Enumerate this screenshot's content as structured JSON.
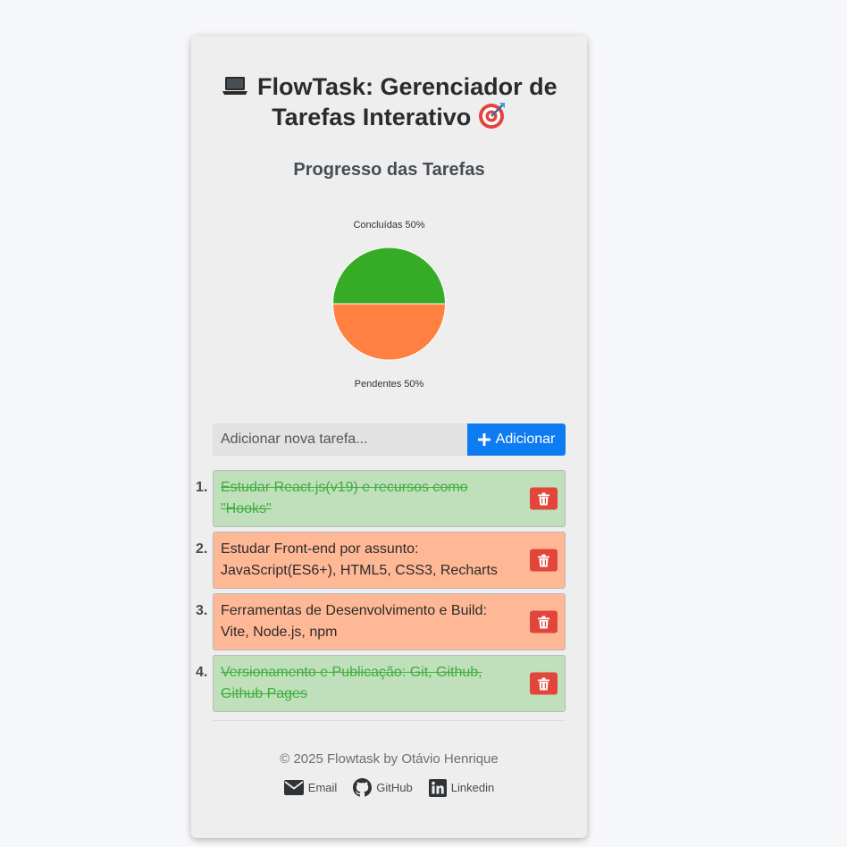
{
  "header": {
    "title_icon": "laptop-icon",
    "title": "FlowTask: Gerenciador de Tarefas Interativo",
    "title_emoji": "target-icon"
  },
  "progress": {
    "heading": "Progresso das Tarefas"
  },
  "chart_data": {
    "type": "pie",
    "slices": [
      {
        "label": "Concluídas 50%",
        "name": "Concluídas",
        "value": 50,
        "color": "#36ac26"
      },
      {
        "label": "Pendentes 50%",
        "name": "Pendentes",
        "value": 50,
        "color": "#ff8041"
      }
    ]
  },
  "add_task": {
    "placeholder": "Adicionar nova tarefa...",
    "button_label": "Adicionar",
    "button_icon": "plus-icon"
  },
  "tasks": [
    {
      "number": "1.",
      "text": "Estudar React.js(v19) e recursos como \"Hooks\"",
      "status": "done"
    },
    {
      "number": "2.",
      "text": "Estudar Front-end por assunto: JavaScript(ES6+), HTML5, CSS3, Recharts",
      "status": "pending"
    },
    {
      "number": "3.",
      "text": "Ferramentas de Desenvolvimento e Build: Vite, Node.js, npm",
      "status": "pending"
    },
    {
      "number": "4.",
      "text": "Versionamento e Publicação: Git, Github, Github Pages",
      "status": "done"
    }
  ],
  "colors": {
    "done_bg": "#c0dfbb",
    "pending_bg": "#ffb896",
    "primary": "#0d7bf2",
    "danger": "#e2453c"
  },
  "footer": {
    "copyright": "© 2025 Flowtask by Otávio Henrique",
    "links": [
      {
        "label": "Email",
        "icon": "envelope-icon"
      },
      {
        "label": "GitHub",
        "icon": "github-icon"
      },
      {
        "label": "Linkedin",
        "icon": "linkedin-icon"
      }
    ]
  }
}
